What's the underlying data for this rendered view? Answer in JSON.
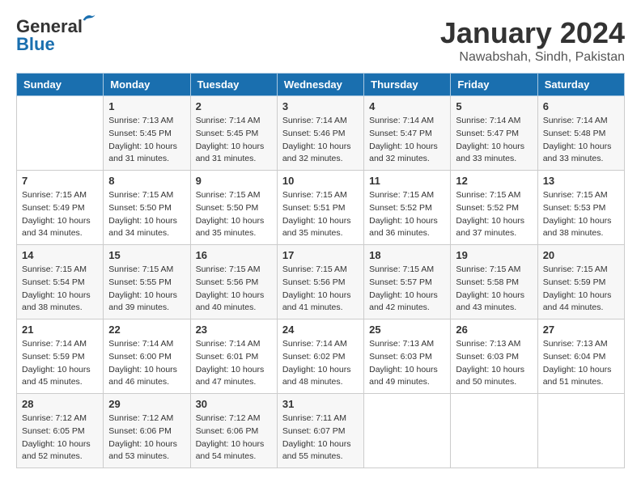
{
  "header": {
    "logo_line1": "General",
    "logo_line2": "Blue",
    "title": "January 2024",
    "subtitle": "Nawabshah, Sindh, Pakistan"
  },
  "days_of_week": [
    "Sunday",
    "Monday",
    "Tuesday",
    "Wednesday",
    "Thursday",
    "Friday",
    "Saturday"
  ],
  "weeks": [
    [
      {
        "date": "",
        "info": ""
      },
      {
        "date": "1",
        "info": "Sunrise: 7:13 AM\nSunset: 5:45 PM\nDaylight: 10 hours\nand 31 minutes."
      },
      {
        "date": "2",
        "info": "Sunrise: 7:14 AM\nSunset: 5:45 PM\nDaylight: 10 hours\nand 31 minutes."
      },
      {
        "date": "3",
        "info": "Sunrise: 7:14 AM\nSunset: 5:46 PM\nDaylight: 10 hours\nand 32 minutes."
      },
      {
        "date": "4",
        "info": "Sunrise: 7:14 AM\nSunset: 5:47 PM\nDaylight: 10 hours\nand 32 minutes."
      },
      {
        "date": "5",
        "info": "Sunrise: 7:14 AM\nSunset: 5:47 PM\nDaylight: 10 hours\nand 33 minutes."
      },
      {
        "date": "6",
        "info": "Sunrise: 7:14 AM\nSunset: 5:48 PM\nDaylight: 10 hours\nand 33 minutes."
      }
    ],
    [
      {
        "date": "7",
        "info": "Sunrise: 7:15 AM\nSunset: 5:49 PM\nDaylight: 10 hours\nand 34 minutes."
      },
      {
        "date": "8",
        "info": "Sunrise: 7:15 AM\nSunset: 5:50 PM\nDaylight: 10 hours\nand 34 minutes."
      },
      {
        "date": "9",
        "info": "Sunrise: 7:15 AM\nSunset: 5:50 PM\nDaylight: 10 hours\nand 35 minutes."
      },
      {
        "date": "10",
        "info": "Sunrise: 7:15 AM\nSunset: 5:51 PM\nDaylight: 10 hours\nand 35 minutes."
      },
      {
        "date": "11",
        "info": "Sunrise: 7:15 AM\nSunset: 5:52 PM\nDaylight: 10 hours\nand 36 minutes."
      },
      {
        "date": "12",
        "info": "Sunrise: 7:15 AM\nSunset: 5:52 PM\nDaylight: 10 hours\nand 37 minutes."
      },
      {
        "date": "13",
        "info": "Sunrise: 7:15 AM\nSunset: 5:53 PM\nDaylight: 10 hours\nand 38 minutes."
      }
    ],
    [
      {
        "date": "14",
        "info": "Sunrise: 7:15 AM\nSunset: 5:54 PM\nDaylight: 10 hours\nand 38 minutes."
      },
      {
        "date": "15",
        "info": "Sunrise: 7:15 AM\nSunset: 5:55 PM\nDaylight: 10 hours\nand 39 minutes."
      },
      {
        "date": "16",
        "info": "Sunrise: 7:15 AM\nSunset: 5:56 PM\nDaylight: 10 hours\nand 40 minutes."
      },
      {
        "date": "17",
        "info": "Sunrise: 7:15 AM\nSunset: 5:56 PM\nDaylight: 10 hours\nand 41 minutes."
      },
      {
        "date": "18",
        "info": "Sunrise: 7:15 AM\nSunset: 5:57 PM\nDaylight: 10 hours\nand 42 minutes."
      },
      {
        "date": "19",
        "info": "Sunrise: 7:15 AM\nSunset: 5:58 PM\nDaylight: 10 hours\nand 43 minutes."
      },
      {
        "date": "20",
        "info": "Sunrise: 7:15 AM\nSunset: 5:59 PM\nDaylight: 10 hours\nand 44 minutes."
      }
    ],
    [
      {
        "date": "21",
        "info": "Sunrise: 7:14 AM\nSunset: 5:59 PM\nDaylight: 10 hours\nand 45 minutes."
      },
      {
        "date": "22",
        "info": "Sunrise: 7:14 AM\nSunset: 6:00 PM\nDaylight: 10 hours\nand 46 minutes."
      },
      {
        "date": "23",
        "info": "Sunrise: 7:14 AM\nSunset: 6:01 PM\nDaylight: 10 hours\nand 47 minutes."
      },
      {
        "date": "24",
        "info": "Sunrise: 7:14 AM\nSunset: 6:02 PM\nDaylight: 10 hours\nand 48 minutes."
      },
      {
        "date": "25",
        "info": "Sunrise: 7:13 AM\nSunset: 6:03 PM\nDaylight: 10 hours\nand 49 minutes."
      },
      {
        "date": "26",
        "info": "Sunrise: 7:13 AM\nSunset: 6:03 PM\nDaylight: 10 hours\nand 50 minutes."
      },
      {
        "date": "27",
        "info": "Sunrise: 7:13 AM\nSunset: 6:04 PM\nDaylight: 10 hours\nand 51 minutes."
      }
    ],
    [
      {
        "date": "28",
        "info": "Sunrise: 7:12 AM\nSunset: 6:05 PM\nDaylight: 10 hours\nand 52 minutes."
      },
      {
        "date": "29",
        "info": "Sunrise: 7:12 AM\nSunset: 6:06 PM\nDaylight: 10 hours\nand 53 minutes."
      },
      {
        "date": "30",
        "info": "Sunrise: 7:12 AM\nSunset: 6:06 PM\nDaylight: 10 hours\nand 54 minutes."
      },
      {
        "date": "31",
        "info": "Sunrise: 7:11 AM\nSunset: 6:07 PM\nDaylight: 10 hours\nand 55 minutes."
      },
      {
        "date": "",
        "info": ""
      },
      {
        "date": "",
        "info": ""
      },
      {
        "date": "",
        "info": ""
      }
    ]
  ]
}
